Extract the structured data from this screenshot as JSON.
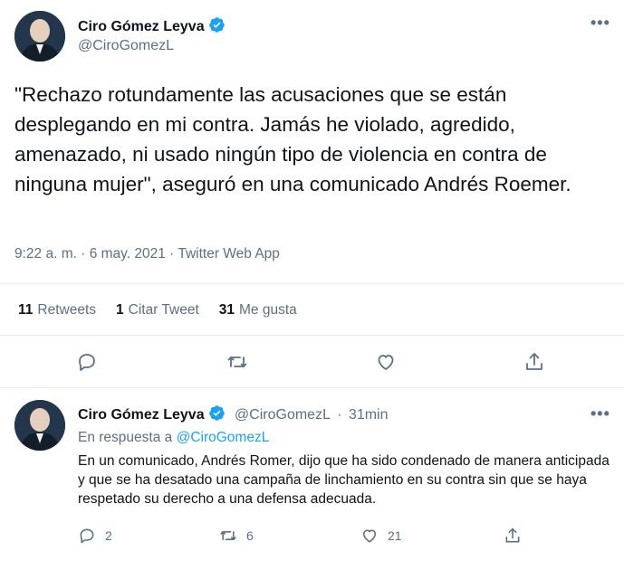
{
  "main_tweet": {
    "author_name": "Ciro Gómez Leyva",
    "author_handle": "@CiroGomezL",
    "text": "\"Rechazo rotundamente las acusaciones que se están desplegando en mi contra. Jamás he violado, agredido, amenazado, ni usado ningún tipo de violencia en contra de ninguna mujer\", aseguró en una comunicado Andrés Roemer.",
    "timestamp": "9:22 a. m. · 6 may. 2021 · Twitter Web App",
    "stats": {
      "retweets_count": "11",
      "retweets_label": "Retweets",
      "quotes_count": "1",
      "quotes_label": "Citar Tweet",
      "likes_count": "31",
      "likes_label": "Me gusta"
    }
  },
  "reply_tweet": {
    "author_name": "Ciro Gómez Leyva",
    "author_handle": "@CiroGomezL",
    "separator": "·",
    "time_ago": "31min",
    "in_reply_prefix": "En respuesta a",
    "in_reply_handle": "@CiroGomezL",
    "text": "En un comunicado, Andrés Romer, dijo que ha sido condenado de manera anticipada y que se ha desatado una campaña de linchamiento en su contra sin que se haya respetado su derecho a una defensa adecuada.",
    "reply_count": "2",
    "retweet_count": "6",
    "like_count": "21"
  },
  "more_glyph": "•••",
  "colors": {
    "accent": "#1da1f2",
    "muted": "#5b7083",
    "text": "#0f1419",
    "divider": "#e6ecf0"
  }
}
